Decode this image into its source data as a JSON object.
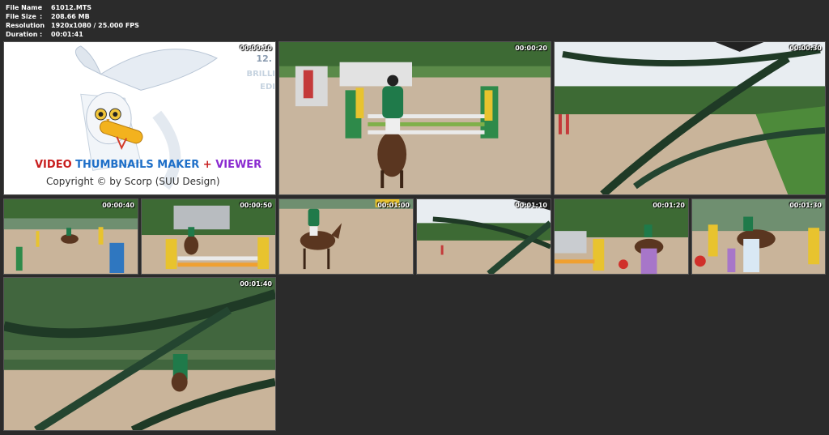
{
  "file_info": {
    "name_key": "File Name",
    "name_val": "61012.MTS",
    "size_key": "File Size",
    "size_val": "208.66 MB",
    "res_key": "Resolution",
    "res_val": "1920x1080 / 25.000 FPS",
    "dur_key": "Duration",
    "dur_val": "00:01:41",
    "sep": ":"
  },
  "logo": {
    "title_part1": "VIDEO",
    "title_part2": "THUMBNAILS MAKER",
    "title_plus": "+",
    "title_part3": "VIEWER",
    "copyright": "Copyright © by Scorp (SUU Design)",
    "side_line1": "12.",
    "side_line2": "BRILLI",
    "side_line3": "EDI"
  },
  "thumbnails": [
    {
      "time": "00:00:10"
    },
    {
      "time": "00:00:20"
    },
    {
      "time": "00:00:30"
    },
    {
      "time": "00:00:40"
    },
    {
      "time": "00:00:50"
    },
    {
      "time": "00:01:00"
    },
    {
      "time": "00:01:10"
    },
    {
      "time": "00:01:20"
    },
    {
      "time": "00:01:30"
    },
    {
      "time": "00:01:40"
    }
  ],
  "colors": {
    "sand": "#c9b49a",
    "grass": "#3f6b35",
    "jacket": "#1f7a4a",
    "horse": "#5a3620",
    "pine": "#1f3a26",
    "sky": "#e9eef2"
  }
}
